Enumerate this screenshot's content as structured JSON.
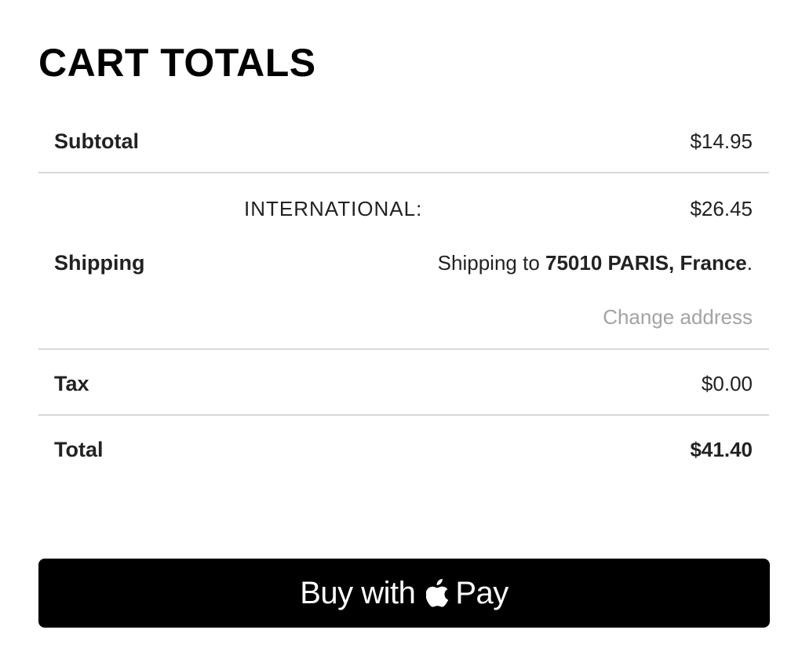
{
  "heading": "CART TOTALS",
  "subtotal": {
    "label": "Subtotal",
    "value": "$14.95"
  },
  "shipping": {
    "label": "Shipping",
    "method": "INTERNATIONAL:",
    "cost": "$26.45",
    "destination_prefix": "Shipping to ",
    "destination": "75010 PARIS, France",
    "destination_suffix": ".",
    "change_address": "Change address"
  },
  "tax": {
    "label": "Tax",
    "value": "$0.00"
  },
  "total": {
    "label": "Total",
    "value": "$41.40"
  },
  "apple_pay_button": {
    "prefix": "Buy with",
    "suffix": "Pay",
    "icon": "apple-logo-icon"
  }
}
